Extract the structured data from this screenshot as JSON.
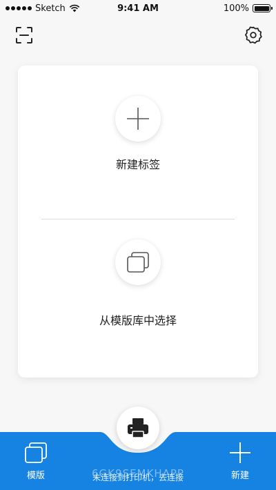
{
  "status_bar": {
    "carrier": "Sketch",
    "time": "9:41 AM",
    "battery": "100%"
  },
  "icons": {
    "scan": "scan-icon",
    "settings": "gear-icon",
    "add": "plus-icon",
    "templates": "stacked-pages-icon",
    "printer": "printer-icon"
  },
  "card": {
    "new_label": "新建标签",
    "template_label": "从模版库中选择"
  },
  "bottom_bar": {
    "template_tab": "模版",
    "new_tab": "新建",
    "connection_status": "未连接到打印机，去连接",
    "watermark": "6GK9SEMKHAPP"
  },
  "colors": {
    "accent": "#1683e3",
    "background": "#f7f7f7",
    "card": "#ffffff"
  }
}
